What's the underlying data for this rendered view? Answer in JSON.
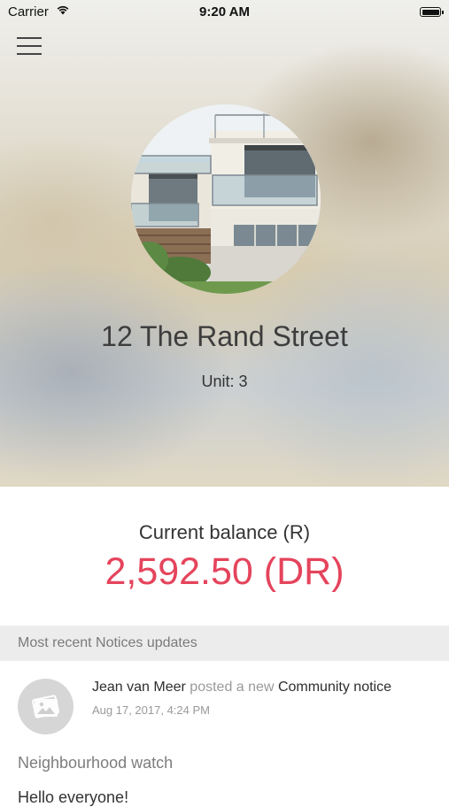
{
  "status_bar": {
    "carrier": "Carrier",
    "time": "9:20 AM",
    "wifi_icon": "wifi-icon",
    "battery_icon": "battery-icon"
  },
  "header": {
    "menu_icon": "hamburger-menu-icon"
  },
  "property": {
    "address": "12 The Rand Street",
    "unit": "Unit: 3"
  },
  "balance": {
    "label": "Current balance (R)",
    "value": "2,592.50 (DR)",
    "color": "#e5445c"
  },
  "notices": {
    "section_title": "Most recent Notices updates",
    "items": [
      {
        "author": "Jean van Meer",
        "action": "posted a new",
        "type": "Community notice",
        "date": "Aug 17, 2017, 4:24 PM",
        "title": "Neighbourhood watch",
        "body": "Hello everyone!",
        "avatar_icon": "image-placeholder-icon"
      }
    ]
  }
}
